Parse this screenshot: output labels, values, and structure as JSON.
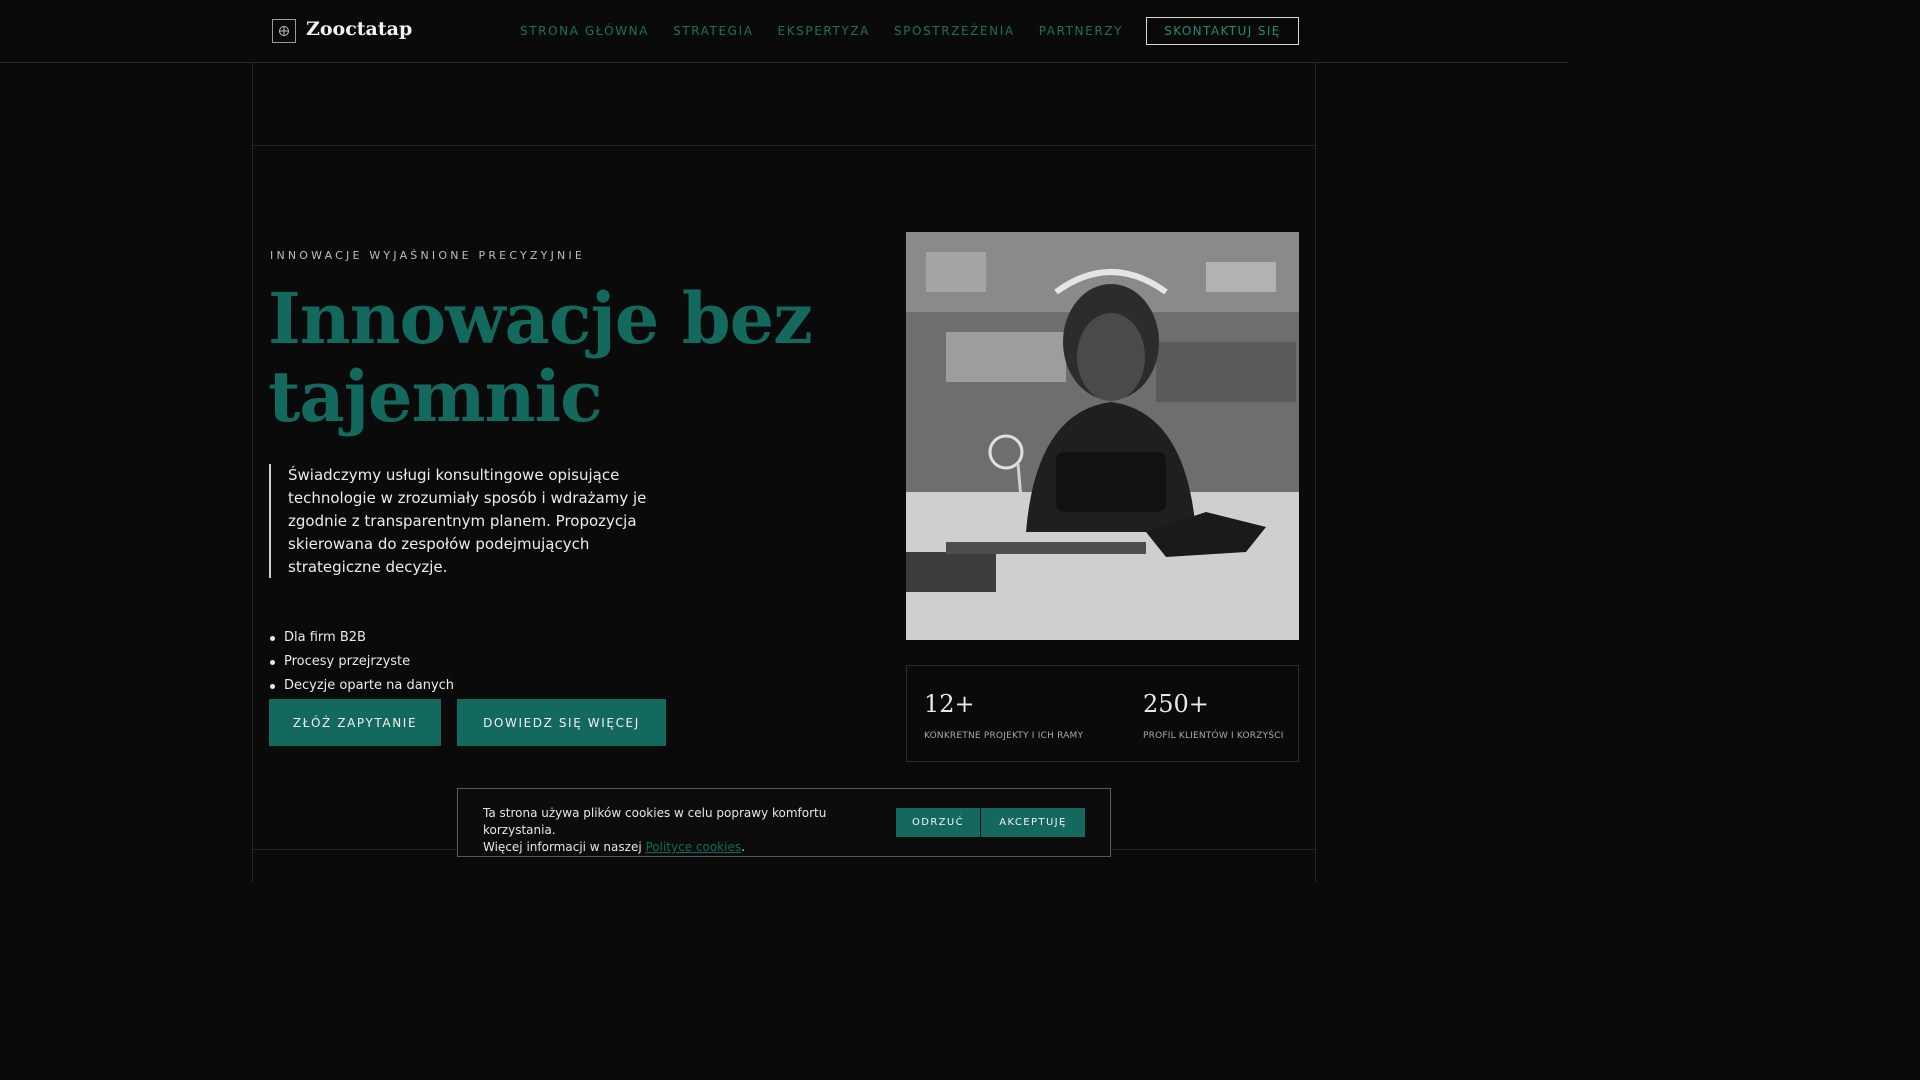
{
  "header": {
    "brand": "Zooctatap",
    "nav": [
      "STRONA GŁÓWNA",
      "STRATEGIA",
      "EKSPERTYZA",
      "SPOSTRZEŻENIA",
      "PARTNERZY"
    ],
    "contact_label": "SKONTAKTUJ SIĘ"
  },
  "hero": {
    "eyebrow": "INNOWACJE WYJAŚNIONE PRECYZYJNIE",
    "title_line1": "Innowacje bez",
    "title_line2": "tajemnic",
    "lead": "Świadczymy usługi konsultingowe opisujące technologie w zrozumiały sposób i wdrażamy je zgodnie z transparentnym planem. Propozycja skierowana do zespołów podejmujących strategiczne decyzje.",
    "bullets": [
      "Dla firm B2B",
      "Procesy przejrzyste",
      "Decyzje oparte na danych"
    ],
    "primary_cta": "ZŁÓŻ ZAPYTANIE",
    "secondary_cta": "DOWIEDZ SIĘ WIĘCEJ"
  },
  "stats": [
    {
      "value": "12+",
      "label": "KONKRETNE PROJEKTY I ICH RAMY"
    },
    {
      "value": "250+",
      "label": "PROFIL KLIENTÓW I KORZYŚCI"
    }
  ],
  "cookie": {
    "text_line1": "Ta strona używa plików cookies w celu poprawy komfortu korzystania.",
    "text_line2_prefix": "Więcej informacji w naszej ",
    "link_text": "Polityce cookies",
    "text_suffix": ".",
    "reject_label": "ODRZUĆ",
    "accept_label": "AKCEPTUJĘ"
  },
  "colors": {
    "accent": "#14695e",
    "background": "#0a0a0a"
  },
  "icons": {
    "logo": "crosshair-circle-icon"
  }
}
